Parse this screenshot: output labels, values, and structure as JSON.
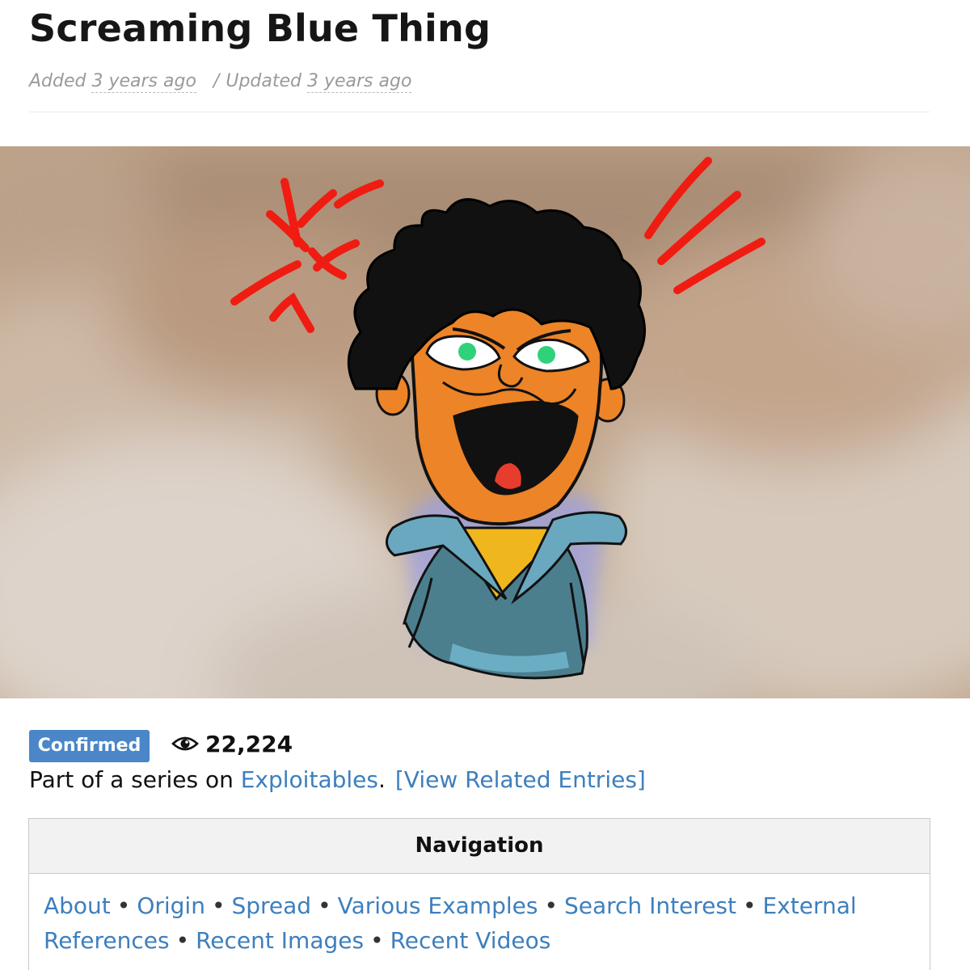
{
  "entry": {
    "title": "Screaming Blue Thing",
    "added_label": "Added",
    "added_when": "3 years ago",
    "separator": "/",
    "updated_label": "Updated",
    "updated_when": "3 years ago"
  },
  "status": {
    "badge": "Confirmed",
    "badge_color": "#4a86c8",
    "view_icon": "eye-icon",
    "views": "22,224"
  },
  "series": {
    "prefix": "Part of a series on",
    "link": "Exploitables",
    "period": ".",
    "related": "[View Related Entries]"
  },
  "navigation": {
    "heading": "Navigation",
    "links": {
      "about": "About",
      "origin": "Origin",
      "spread": "Spread",
      "various_examples": "Various Examples",
      "search_interest": "Search Interest",
      "external_references_1": "External",
      "external_references_2": "References",
      "recent_images": "Recent Images",
      "recent_videos": "Recent Videos"
    },
    "bullet": "•"
  },
  "colors": {
    "link": "#3d7fbd",
    "title": "#161616",
    "meta": "#9a9a9a"
  }
}
